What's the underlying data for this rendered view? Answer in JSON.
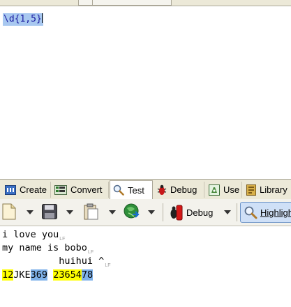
{
  "regex": {
    "expression": "\\d{1,5}"
  },
  "tabs": [
    {
      "label": "Create",
      "icon": "create-icon"
    },
    {
      "label": "Convert",
      "icon": "convert-icon"
    },
    {
      "label": "Test",
      "icon": "magnifier-icon",
      "active": true
    },
    {
      "label": "Debug",
      "icon": "bug-icon"
    },
    {
      "label": "Use",
      "icon": "use-icon"
    },
    {
      "label": "Library",
      "icon": "library-icon"
    }
  ],
  "toolbar": {
    "debug_label": "Debug",
    "highlight_label": "Highlight"
  },
  "test_text": {
    "line1": "i love you",
    "line2": "my name is bobo",
    "line3": "          huihui ^",
    "line4": {
      "m1": "12",
      "t1": "JKE",
      "m2": "369",
      "t2": " ",
      "m3": "23654",
      "m4": "78"
    },
    "eol_marker": "LF"
  },
  "colors": {
    "match_a": "#ffff00",
    "match_b": "#7fb2ea",
    "selection": "#a8c8f0"
  }
}
